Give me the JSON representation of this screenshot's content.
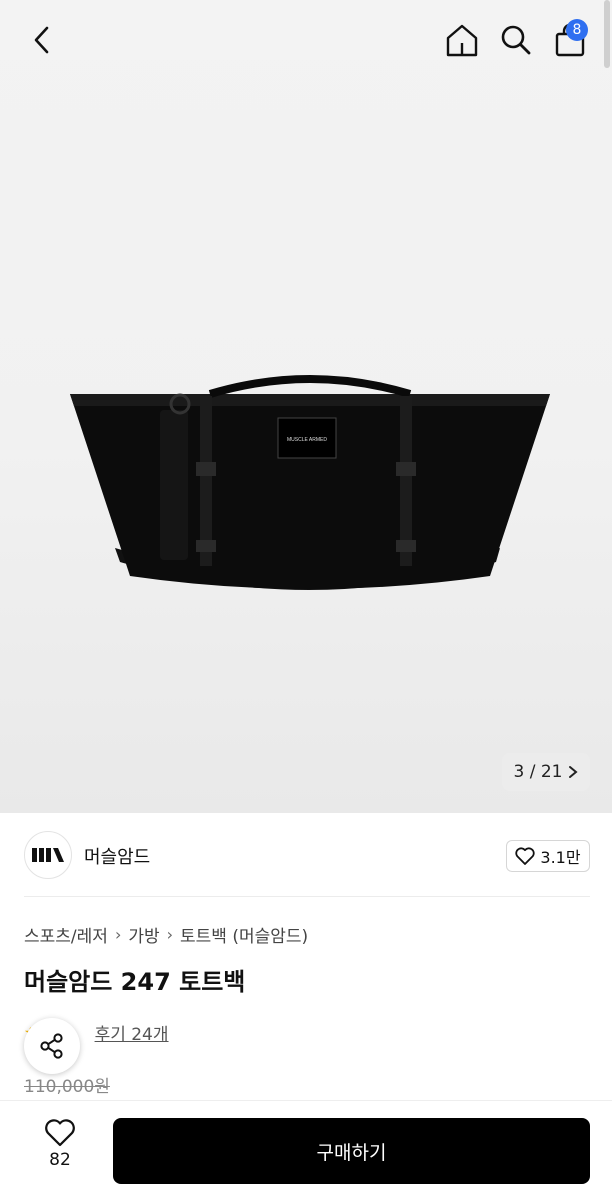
{
  "header": {
    "back_icon": "chevron-left-icon",
    "home_icon": "home-icon",
    "search_icon": "search-icon",
    "cart_icon": "shopping-bag-icon",
    "cart_count": "8",
    "badge_color": "#2f6ff0"
  },
  "gallery": {
    "counter": "3 / 21",
    "counter_icon": "chevron-right-icon",
    "logo_text": "MUSCLE ARMED"
  },
  "brand": {
    "name": "머슬암드",
    "likes": "3.1만"
  },
  "breadcrumb": {
    "items": [
      "스포츠/레저",
      "가방",
      "토트백 (머슬암드)"
    ]
  },
  "product": {
    "title": "머슬암드 247 토트백",
    "review_link": "후기 24개",
    "original_price": "110,000원"
  },
  "bottom_bar": {
    "wish_count": "82",
    "buy_label": "구매하기",
    "buy_color": "#000000"
  }
}
